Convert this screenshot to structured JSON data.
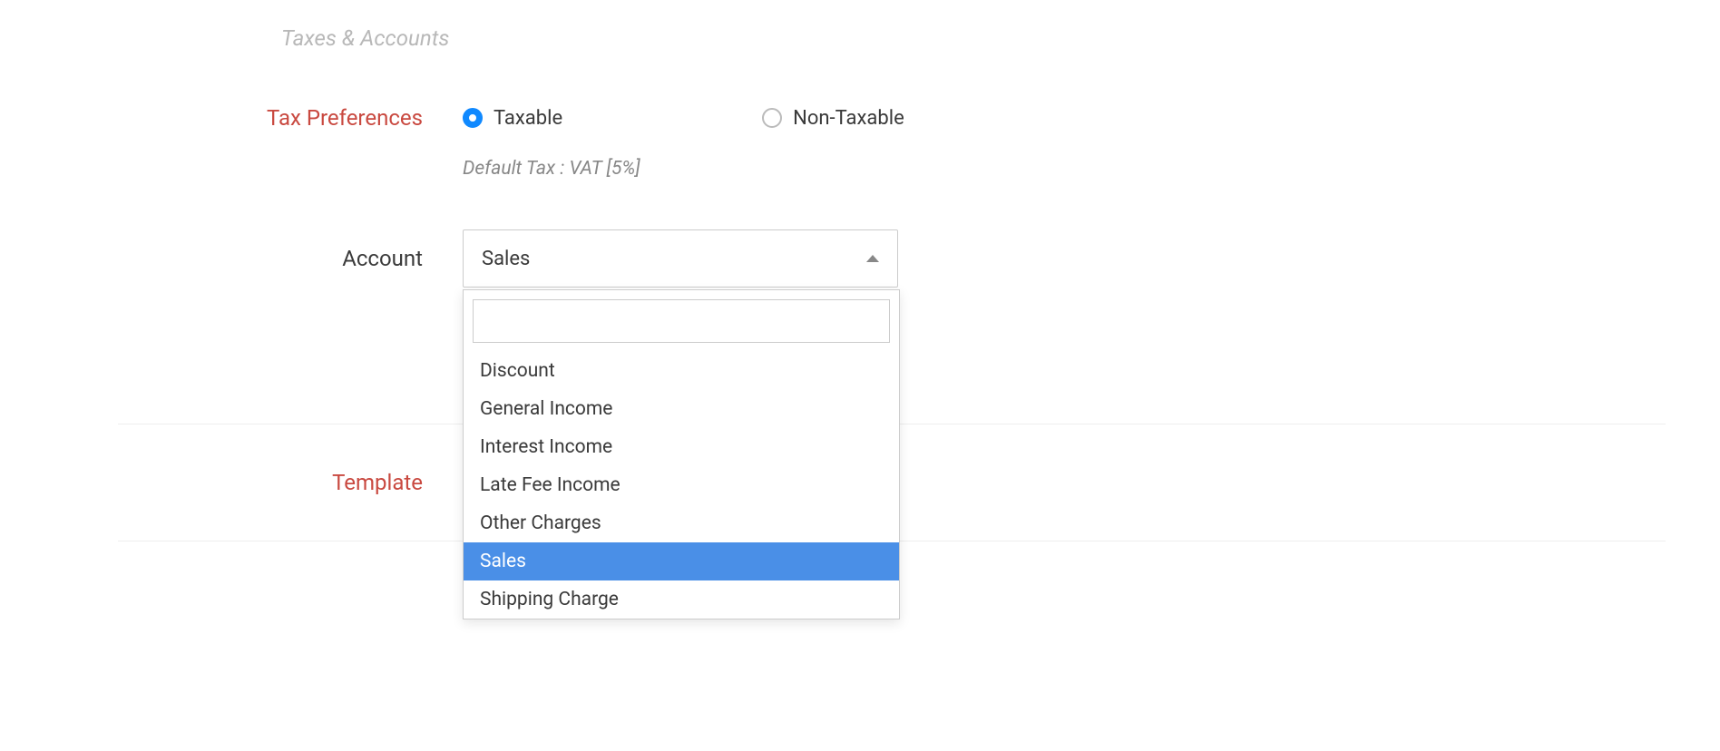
{
  "section": {
    "heading": "Taxes & Accounts"
  },
  "taxPreferences": {
    "label": "Tax Preferences",
    "options": {
      "taxable": "Taxable",
      "nonTaxable": "Non-Taxable"
    },
    "defaultTaxLabel": "Default Tax : VAT [5%]"
  },
  "account": {
    "label": "Account",
    "selected": "Sales",
    "searchValue": "",
    "options": [
      "Discount",
      "General Income",
      "Interest Income",
      "Late Fee Income",
      "Other Charges",
      "Sales",
      "Shipping Charge"
    ]
  },
  "template": {
    "label": "Template"
  }
}
